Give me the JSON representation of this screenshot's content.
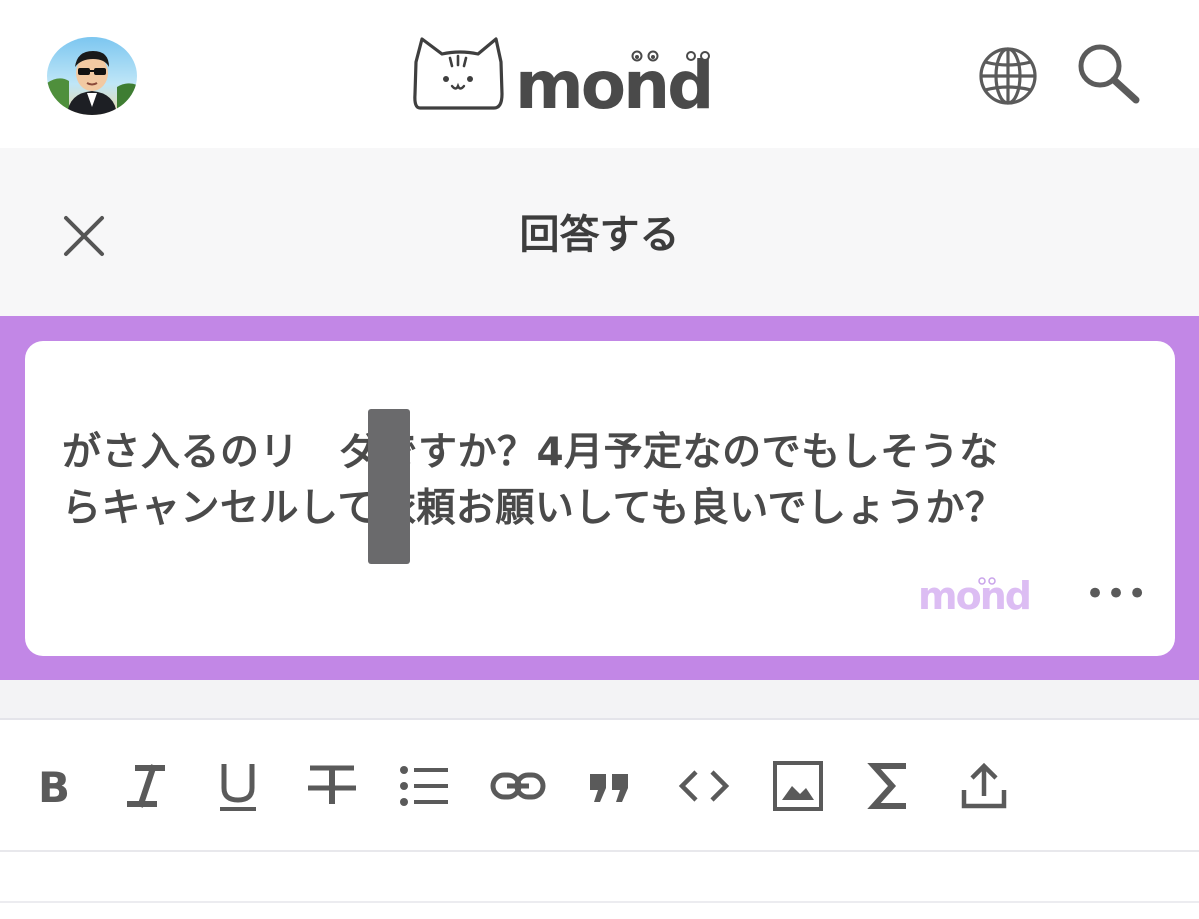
{
  "header": {
    "avatar_icon": "user-avatar",
    "logo_text": "mond",
    "globe_icon": "globe-icon",
    "search_icon": "search-icon"
  },
  "answer_dialog": {
    "close_icon": "close-icon",
    "title": "回答する"
  },
  "question": {
    "line1_before": "がさ入るのリ",
    "line1_after": "ダですか？4月予定なのでもしそうな",
    "line2": "らキャンセルして依頼お願いしても良いでしょうか？",
    "watermark": "mond",
    "more_label": "•••",
    "band_color": "#c287e6"
  },
  "toolbar": {
    "tools": [
      {
        "name": "bold",
        "icon": "bold-icon"
      },
      {
        "name": "italic",
        "icon": "italic-icon"
      },
      {
        "name": "underline",
        "icon": "underline-icon"
      },
      {
        "name": "strikethrough",
        "icon": "strikethrough-icon"
      },
      {
        "name": "bulleted-list",
        "icon": "list-icon"
      },
      {
        "name": "link",
        "icon": "link-icon"
      },
      {
        "name": "quote",
        "icon": "quote-icon"
      },
      {
        "name": "code",
        "icon": "code-icon"
      },
      {
        "name": "image",
        "icon": "image-icon"
      },
      {
        "name": "math",
        "icon": "sigma-icon"
      },
      {
        "name": "upload",
        "icon": "upload-icon"
      }
    ]
  }
}
